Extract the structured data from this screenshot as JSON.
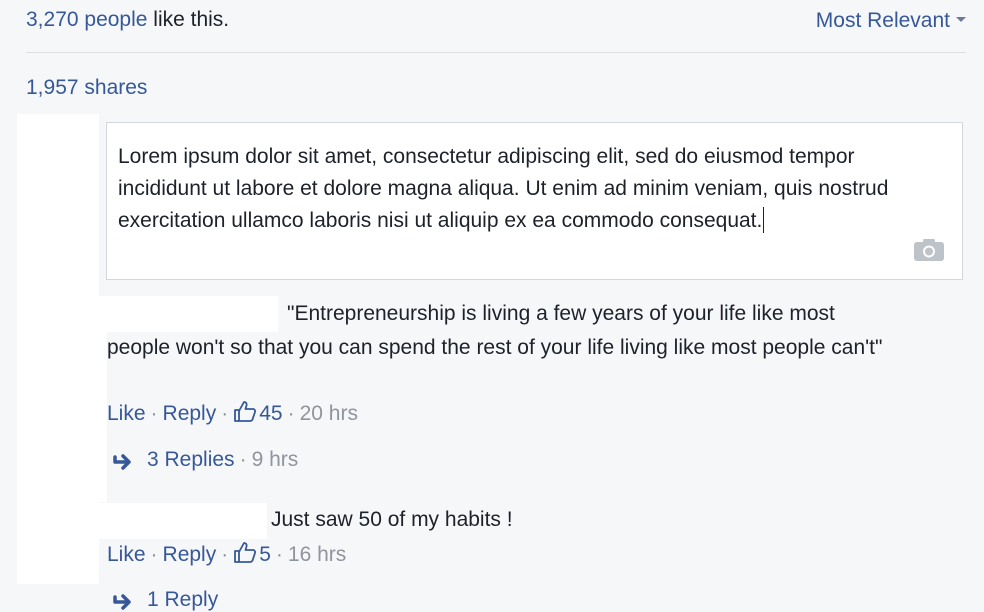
{
  "summary": {
    "likes_count": "3,270 people",
    "likes_suffix": " like this.",
    "sort_label": "Most Relevant",
    "shares": "1,957 shares"
  },
  "composer": {
    "text": "Lorem ipsum dolor sit amet, consectetur adipiscing elit, sed do eiusmod tempor incididunt ut labore et dolore magna aliqua. Ut enim ad minim veniam, quis nostrud exercitation ullamco laboris nisi ut aliquip ex ea commodo consequat.",
    "icon": "camera-icon"
  },
  "comments": [
    {
      "text_line1": "\"Entrepreneurship is living a few years of your life like most",
      "text_rest": "people won't so that you can spend the rest of your life living like most people can't\"",
      "like_label": "Like",
      "reply_label": "Reply",
      "reaction_count": "45",
      "time": "20 hrs",
      "replies_label": "3 Replies",
      "replies_time": "9 hrs"
    },
    {
      "text": "Just saw 50 of my habits !",
      "like_label": "Like",
      "reply_label": "Reply",
      "reaction_count": "5",
      "time": "16 hrs",
      "replies_label": "1 Reply"
    }
  ],
  "colors": {
    "link": "#365899",
    "muted": "#90949c",
    "background": "#f6f7f9"
  }
}
